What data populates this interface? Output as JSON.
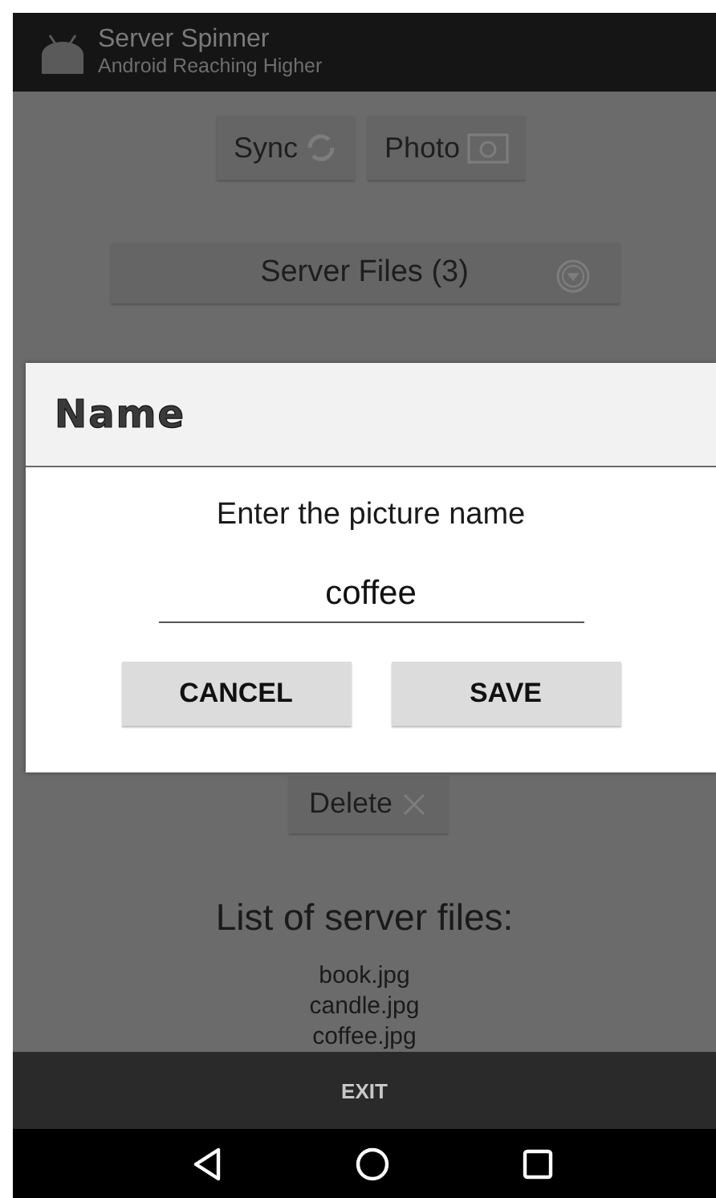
{
  "app_bar": {
    "title": "Server Spinner",
    "subtitle": "Android Reaching Higher"
  },
  "buttons": [
    {
      "label": "Sync"
    },
    {
      "label": "Photo"
    }
  ],
  "spinner": {
    "value": "Server Files (3)"
  },
  "delete_button": {
    "label": "Delete"
  },
  "list_heading": "List of server files:",
  "files": [
    "book.jpg",
    "candle.jpg",
    "coffee.jpg"
  ],
  "bottom_bar": {
    "button": "EXIT"
  },
  "dialog": {
    "title": "Name",
    "message": "Enter the picture name",
    "input": {
      "value": "coffee"
    },
    "buttons": [
      "CANCEL",
      "SAVE"
    ]
  }
}
